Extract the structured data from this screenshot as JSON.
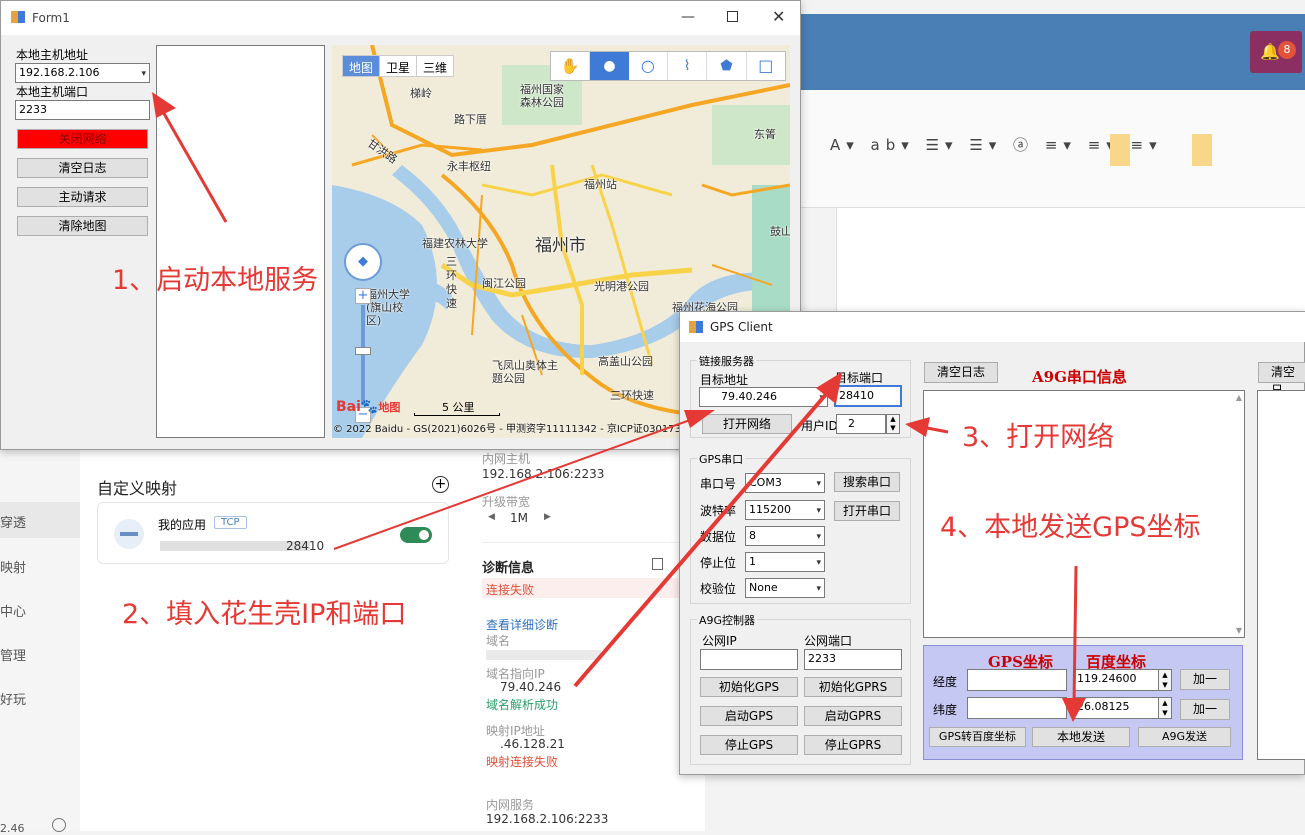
{
  "background_app": {
    "bell_badge": "8",
    "mapping_title": "自定义映射",
    "app_name": "我的应用",
    "app_protocol": "TCP",
    "app_port": "28410",
    "sidebar_items": [
      "穿透",
      "映射",
      "中心",
      "管理",
      "好玩"
    ],
    "sidebar_bottom": "2.46",
    "intranet_host_label": "内网主机",
    "intranet_host_value": "192.168.2.106:2233",
    "bandwidth_label": "升级带宽",
    "bandwidth_value": "1M",
    "diag_title": "诊断信息",
    "diag_status": "连接失败",
    "diag_link": "查看详细诊断",
    "domain_label": "域名",
    "domain_ip_label": "域名指向IP",
    "domain_ip_value": "79.40.246",
    "domain_ok": "域名解析成功",
    "map_ip_label": "映射IP地址",
    "map_ip_value": ".46.128.21",
    "map_fail": "映射连接失败",
    "inner_service_label": "内网服务",
    "inner_service_value": "192.168.2.106:2233"
  },
  "form1": {
    "title": "Form1",
    "host_label": "本地主机地址",
    "host_value": "192.168.2.106",
    "port_label": "本地主机端口",
    "port_value": "2233",
    "close_btn": "关闭网络",
    "clear_log_btn": "清空日志",
    "request_btn": "主动请求",
    "clear_map_btn": "清除地图",
    "map_tabs": [
      "地图",
      "卫星",
      "三维"
    ],
    "map_labels": [
      "福州国家森林公园",
      "梯岭",
      "路下厝",
      "东箐",
      "永丰枢纽",
      "福州站",
      "福建农林大学",
      "福州市",
      "闽江公园",
      "光明港公园",
      "鼓山",
      "福州大学(旗山校区)",
      "福州花海公园",
      "飞凤山奥体主题公园",
      "高盖山公园",
      "三环快速",
      "甘洪路",
      "三环快速"
    ],
    "scale": "5 公里",
    "copyright": "© 2022 Baidu - GS(2021)6026号 - 甲测资字11111342 - 京ICP证030173号",
    "baidu_logo": "Bai",
    "baidu_map": "地图"
  },
  "gps_client": {
    "title": "GPS Client",
    "server_group": "链接服务器",
    "target_addr_label": "目标地址",
    "target_addr_value": "79.40.246",
    "target_port_label": "目标端口",
    "target_port_value": "28410",
    "open_net_btn": "打开网络",
    "user_id_label": "用户ID",
    "user_id_value": "2",
    "serial_group": "GPS串口",
    "com_label": "串口号",
    "com_value": "COM3",
    "search_btn": "搜索串口",
    "baud_label": "波特率",
    "baud_value": "115200",
    "open_serial_btn": "打开串口",
    "data_bits_label": "数据位",
    "data_bits_value": "8",
    "stop_bits_label": "停止位",
    "stop_bits_value": "1",
    "parity_label": "校验位",
    "parity_value": "None",
    "a9g_group": "A9G控制器",
    "public_ip_label": "公网IP",
    "public_port_label": "公网端口",
    "public_port_value": "2233",
    "init_gps_btn": "初始化GPS",
    "init_gprs_btn": "初始化GPRS",
    "start_gps_btn": "启动GPS",
    "start_gprs_btn": "启动GPRS",
    "stop_gps_btn": "停止GPS",
    "stop_gprs_btn": "停止GPRS",
    "clear_log_btn": "清空日志",
    "serial_info_title": "A9G串口信息",
    "clear_right_btn": "清空日",
    "gps_coord_title": "GPS坐标",
    "baidu_coord_title": "百度坐标",
    "lng_label": "经度",
    "lng_value": "119.24600",
    "lat_label": "纬度",
    "lat_value": "26.08125",
    "add_btn": "加一",
    "add_btn2": "加一",
    "convert_btn": "GPS转百度坐标",
    "local_send_btn": "本地发送",
    "a9g_send_btn": "A9G发送"
  },
  "annotations": {
    "step1": "1、启动本地服务",
    "step2": "2、填入花生壳IP和端口",
    "step3": "3、打开网络",
    "step4": "4、本地发送GPS坐标"
  },
  "colors": {
    "header_blue": "#4a7fb5",
    "annotation_red": "#e53935",
    "close_btn_red": "#ff0000",
    "coord_panel": "#c5c8f3",
    "toggle_green": "#2e8b57"
  }
}
